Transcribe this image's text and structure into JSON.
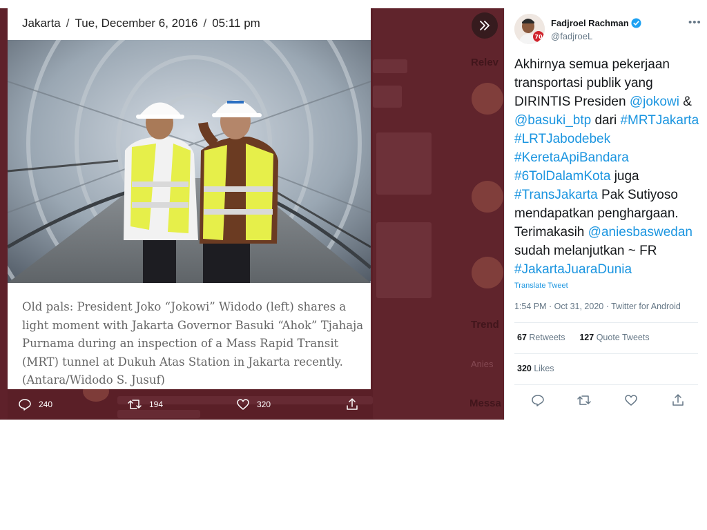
{
  "article": {
    "location": "Jakarta",
    "date": "Tue, December 6, 2016",
    "time": "05:11 pm",
    "caption": "Old pals: President Joko “Jokowi” Widodo (left) shares a light moment with Jakarta Governor Basuki “Ahok” Tjahaja Purnama during an inspection of a Mass Rapid Transit (MRT) tunnel at Dukuh Atas Station in Jakarta recently.(Antara/Widodo S. Jusuf)"
  },
  "media_actions": {
    "reply_count": "240",
    "retweet_count": "194",
    "like_count": "320"
  },
  "tweet": {
    "author_name": "Fadjroel Rachman",
    "author_handle": "@fadjroeL",
    "text_parts": [
      {
        "t": "Akhirnya semua pekerjaan transportasi publik yang DIRINTIS Presiden ",
        "link": false
      },
      {
        "t": "@jokowi",
        "link": true
      },
      {
        "t": " & ",
        "link": false
      },
      {
        "t": "@basuki_btp",
        "link": true
      },
      {
        "t": " dari ",
        "link": false
      },
      {
        "t": "#MRTJakarta",
        "link": true
      },
      {
        "t": " ",
        "link": false
      },
      {
        "t": "#LRTJabodebek",
        "link": true
      },
      {
        "t": " ",
        "link": false
      },
      {
        "t": "#KeretaApiBandara",
        "link": true
      },
      {
        "t": " ",
        "link": false
      },
      {
        "t": "#6TolDalamKota",
        "link": true
      },
      {
        "t": " juga ",
        "link": false
      },
      {
        "t": "#TransJakarta",
        "link": true
      },
      {
        "t": " Pak Sutiyoso mendapatkan penghargaan. Terimakasih ",
        "link": false
      },
      {
        "t": "@aniesbaswedan",
        "link": true
      },
      {
        "t": " sudah melanjutkan ~ FR ",
        "link": false
      },
      {
        "t": "#JakartaJuaraDunia",
        "link": true
      }
    ],
    "translate_label": "Translate Tweet",
    "timestamp": "1:54 PM · Oct 31, 2020 · Twitter for Android",
    "retweets_count": "67",
    "retweets_label": "Retweets",
    "quote_count": "127",
    "quote_label": "Quote Tweets",
    "likes_count": "320",
    "likes_label": "Likes"
  },
  "backdrop": {
    "relevant_label": "Relev",
    "trends_label": "Trend",
    "messages_label": "Messa",
    "anies_label": "Anies"
  },
  "colors": {
    "link": "#1b95e0",
    "backdrop": "#5a1f27",
    "verified": "#1da1f2"
  }
}
